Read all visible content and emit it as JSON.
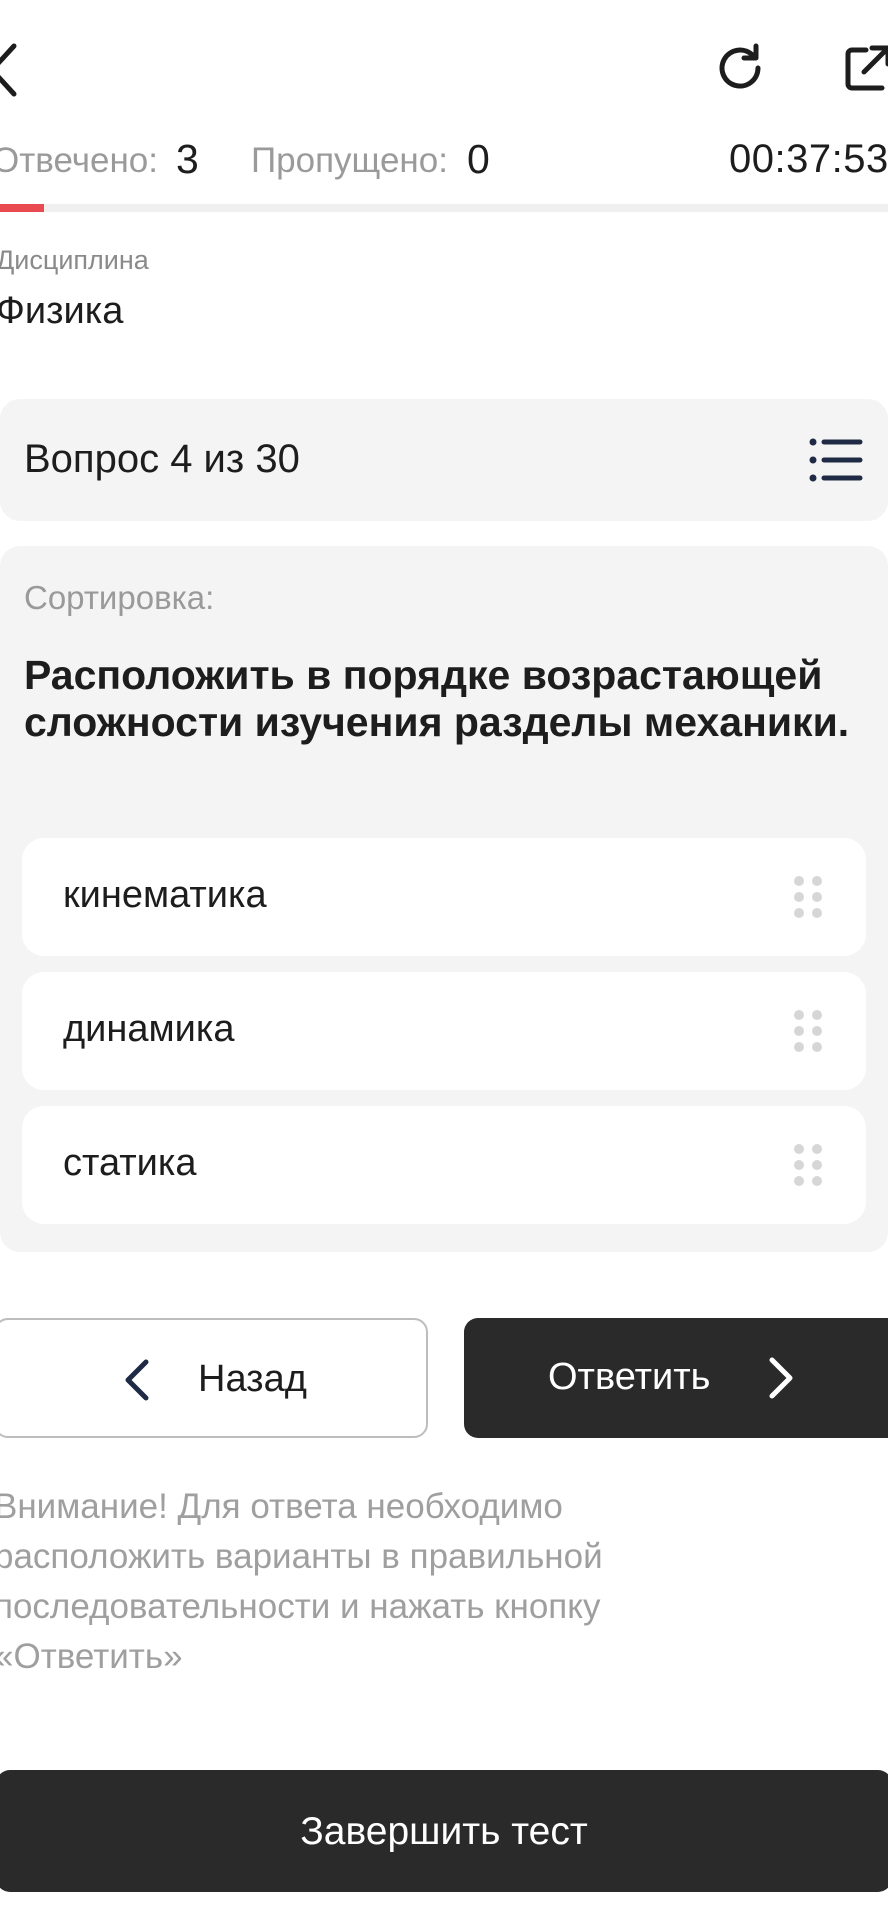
{
  "header": {
    "back_icon": "chevron-left-icon",
    "refresh_icon": "refresh-icon",
    "share_icon": "external-link-icon"
  },
  "stats": {
    "answered_label": "Отвечено:",
    "answered_value": "3",
    "skipped_label": "Пропущено:",
    "skipped_value": "0",
    "timer": "00:37:53"
  },
  "progress": {
    "fraction": 0.05,
    "color": "#e84a4f"
  },
  "discipline": {
    "label": "Дисциплина",
    "value": "Физика"
  },
  "question_header": {
    "title": "Вопрос 4 из 30",
    "list_icon": "list-icon"
  },
  "question": {
    "type": "Сортировка:",
    "text": "Расположить в порядке возрастающей сложности изучения разделы механики.",
    "options": [
      {
        "label": "кинематика",
        "handle_icon": "drag-handle-icon"
      },
      {
        "label": "динамика",
        "handle_icon": "drag-handle-icon"
      },
      {
        "label": "статика",
        "handle_icon": "drag-handle-icon"
      }
    ]
  },
  "buttons": {
    "back_label": "Назад",
    "answer_label": "Ответить",
    "finish_label": "Завершить тест"
  },
  "notice": "Внимание! Для ответа необходимо расположить варианты в правильной последовательности и нажать кнопку «Ответить»",
  "colors": {
    "dark": "#2a2a2a",
    "card_bg": "#f4f4f4",
    "muted_text": "#9a9a9a"
  }
}
